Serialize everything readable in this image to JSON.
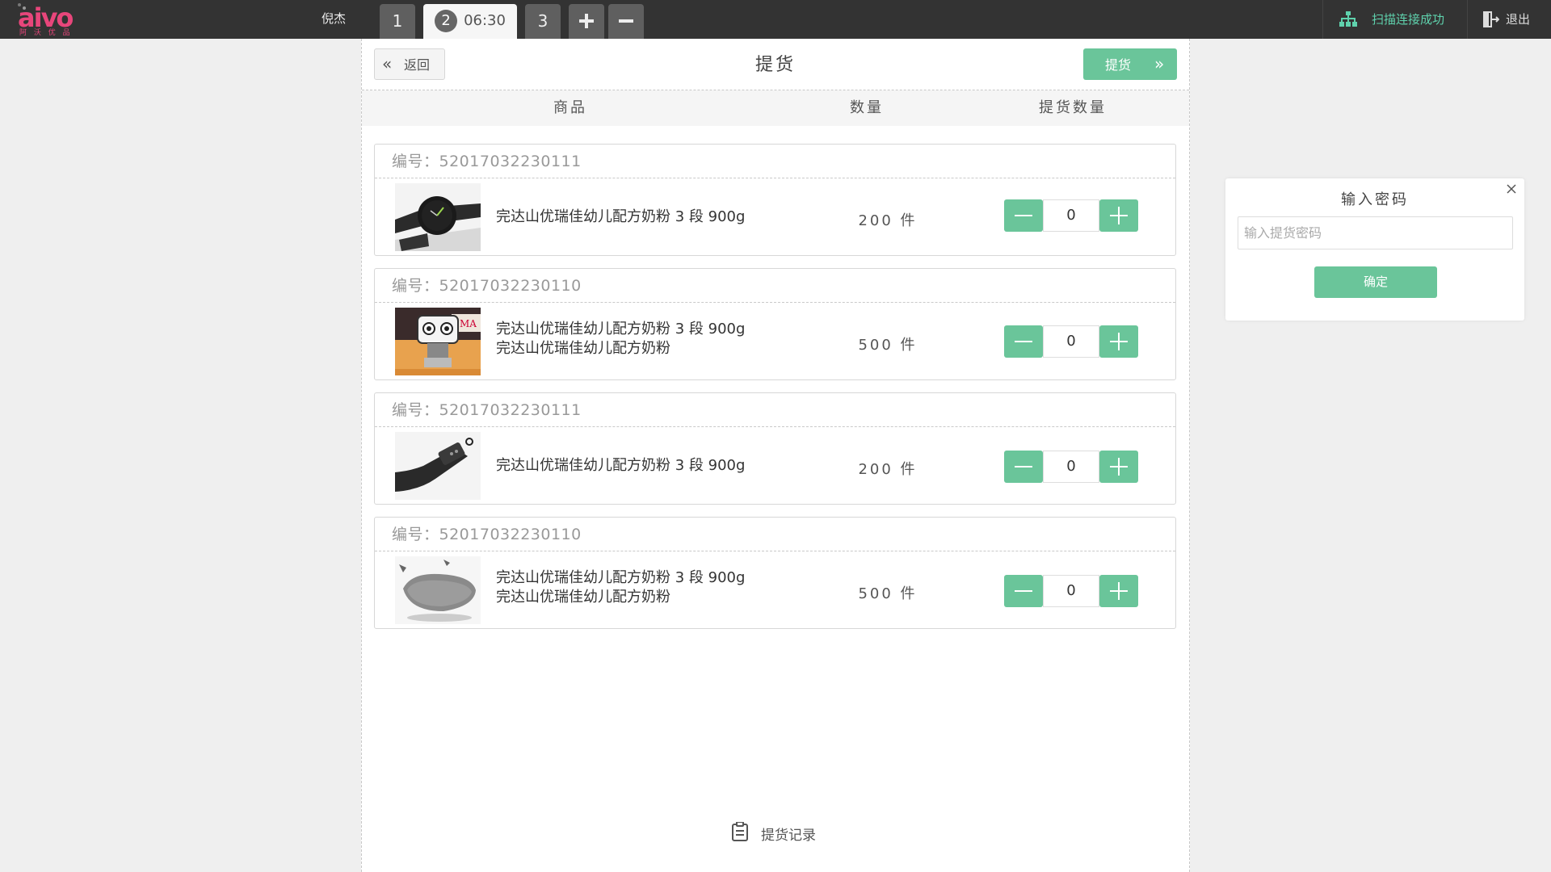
{
  "topbar": {
    "logo_text": "aivo",
    "logo_sub": "阿 沃 优 品",
    "user_name": "倪杰",
    "tabs": [
      {
        "label": "1"
      },
      {
        "number": "2",
        "time": "06:30"
      },
      {
        "label": "3"
      }
    ],
    "add_tab_icon": "+",
    "remove_tab_icon": "−",
    "scan_status": "扫描连接成功",
    "logout_label": "退出"
  },
  "header": {
    "back_label": "返回",
    "back_icon": "«",
    "title": "提货",
    "pick_label": "提货",
    "pick_icon": "»"
  },
  "columns": {
    "product": "商品",
    "quantity": "数量",
    "pick_quantity": "提货数量"
  },
  "items": [
    {
      "code": "编号：52017032230111",
      "name_lines": [
        "完达山优瑞佳幼儿配方奶粉 3 段 900g"
      ],
      "qty": "200 件",
      "pick_qty": "0",
      "image": "watch"
    },
    {
      "code": "编号：52017032230110",
      "name_lines": [
        "完达山优瑞佳幼儿配方奶粉 3 段 900g",
        "完达山优瑞佳幼儿配方奶粉"
      ],
      "qty": "500 件",
      "pick_qty": "0",
      "image": "robot-toy"
    },
    {
      "code": "编号：52017032230111",
      "name_lines": [
        "完达山优瑞佳幼儿配方奶粉 3 段 900g"
      ],
      "qty": "200 件",
      "pick_qty": "0",
      "image": "camera"
    },
    {
      "code": "编号：52017032230110",
      "name_lines": [
        "完达山优瑞佳幼儿配方奶粉 3 段 900g",
        "完达山优瑞佳幼儿配方奶粉"
      ],
      "qty": "500 件",
      "pick_qty": "0",
      "image": "vr-headset"
    }
  ],
  "footer": {
    "record_label": "提货记录",
    "record_icon": "clipboard-icon"
  },
  "password_popup": {
    "title": "输入密码",
    "placeholder": "输入提货密码",
    "value": "",
    "confirm_label": "确定"
  },
  "colors": {
    "accent_green": "#6ac59a",
    "scan_green": "#5fd2ad",
    "topbar": "#333333",
    "brand_pink": "#e8467b"
  }
}
